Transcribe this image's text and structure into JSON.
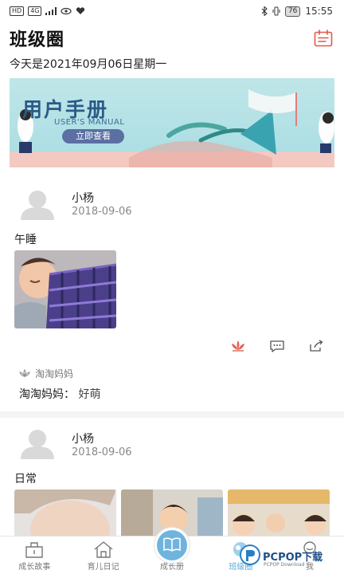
{
  "status_bar": {
    "network_label": "HD",
    "signal_label": "4G",
    "battery_level": "76",
    "time": "15:55"
  },
  "header": {
    "title": "班级圈"
  },
  "date_line": "今天是2021年09月06日星期一",
  "banner": {
    "title": "用户手册",
    "subtitle": "USER'S MANUAL",
    "button_label": "立即查看",
    "colors": {
      "bg": "#bfe6e9",
      "title": "#2b5a86",
      "button": "#5b6fa3"
    }
  },
  "posts": [
    {
      "author": "小杨",
      "date": "2018-09-06",
      "text": "午睡",
      "likes": "淘淘妈妈",
      "comment": {
        "author": "淘淘妈妈：",
        "text": "好萌"
      }
    },
    {
      "author": "小杨",
      "date": "2018-09-06",
      "text": "日常"
    }
  ],
  "tabbar": {
    "items": [
      {
        "label": "成长故事",
        "icon": "story-icon"
      },
      {
        "label": "育儿日记",
        "icon": "home-icon"
      },
      {
        "label": "成长册",
        "icon": "book-icon"
      },
      {
        "label": "班级圈",
        "icon": "class-circle-icon"
      },
      {
        "label": "我",
        "icon": "profile-icon"
      }
    ],
    "active_index": 3,
    "accent": "#55a9d8"
  },
  "watermark": {
    "text": "PCPOP下载",
    "sub": "PCPOP Download"
  }
}
